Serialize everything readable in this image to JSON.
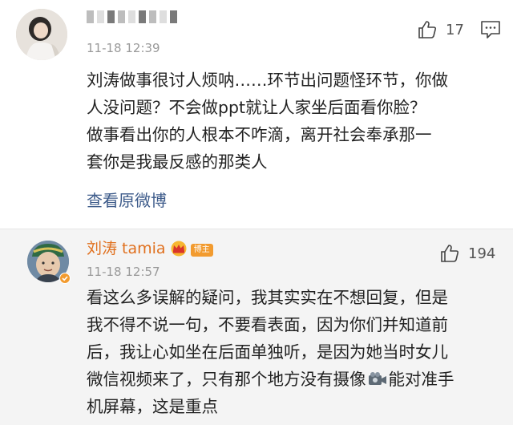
{
  "comment1": {
    "username": "",
    "timestamp": "11-18 12:39",
    "like_count": "17",
    "lines": [
      "刘涛做事很讨人烦呐……环节出问题怪环节，你做",
      "人没问题？不会做ppt就让人家坐后面看你脸？",
      "做事看出你的人根本不咋滴，离开社会奉承那一",
      "套你是我最反感的那类人"
    ],
    "view_original": "查看原微博",
    "icons": {
      "like": "thumbs-up-icon",
      "reply": "comment-icon"
    }
  },
  "comment2": {
    "username": "刘涛 tamia",
    "badge": "博主",
    "timestamp": "11-18 12:57",
    "like_count": "194",
    "lines": [
      "看这么多误解的疑问，我其实实在不想回复，但是",
      "我不得不说一句，不要看表面，因为你们并知道前",
      "后，我让心如坐在后面单独听，是因为她当时女儿",
      "微信视频来了，只有那个地方没有摄像",
      "机屏幕，这是重点"
    ],
    "line4_suffix": "能对准手",
    "colors": {
      "username": "#e0701e",
      "badge": "#f29b2f",
      "link": "#3d5b8a"
    },
    "icons": {
      "crown": "crown-icon",
      "verified": "verified-icon",
      "camera": "video-camera-icon",
      "like": "thumbs-up-icon"
    }
  }
}
